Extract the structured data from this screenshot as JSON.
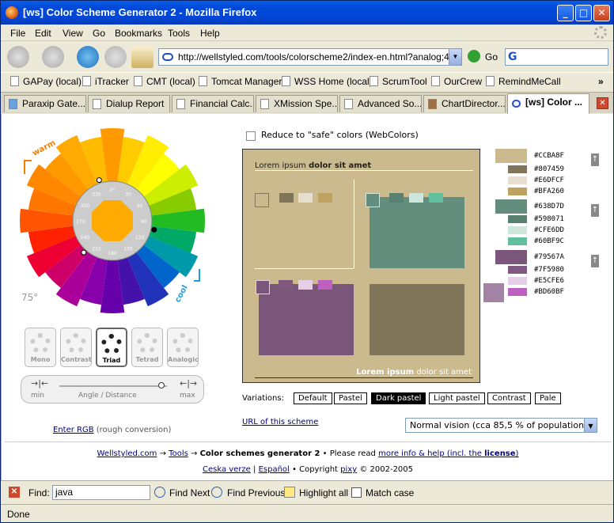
{
  "window": {
    "title": "[ws] Color Scheme Generator 2 - Mozilla Firefox",
    "minimize": "_",
    "maximize": "□",
    "close": "✕"
  },
  "menu": [
    "File",
    "Edit",
    "View",
    "Go",
    "Bookmarks",
    "Tools",
    "Help"
  ],
  "nav": {
    "url": "http://wellstyled.com/tools/colorscheme2/index-en.html?analog;46;0;",
    "go_label": "Go",
    "search_value": "G"
  },
  "bookmarks": [
    "GAPay (local)",
    "iTracker",
    "CMT (local)",
    "Tomcat Manager",
    "WSS Home (local)",
    "ScrumTool",
    "OurCrew",
    "RemindMeCall"
  ],
  "bookmarks_more": "»",
  "tabs": [
    "Paraxip Gate...",
    "Dialup Report",
    "Financial Calc...",
    "XMission Spe...",
    "Advanced So...",
    "ChartDirector...",
    "[ws] Color ..."
  ],
  "tab_close": "✕",
  "wheel": {
    "warm_label": "warm",
    "cool_label": "cool",
    "angle_label": "75°",
    "degree_ticks": [
      "0°",
      "30",
      "60",
      "90",
      "120",
      "150",
      "180",
      "210",
      "240",
      "270",
      "300",
      "330"
    ]
  },
  "modes": [
    {
      "label": "Mono"
    },
    {
      "label": "Contrast"
    },
    {
      "label": "Triad",
      "selected": true
    },
    {
      "label": "Tetrad"
    },
    {
      "label": "Analogic"
    }
  ],
  "slider": {
    "label": "Angle / Distance",
    "min": "min",
    "max": "max",
    "position": 0.95
  },
  "enter_rgb": {
    "link": "Enter RGB",
    "note": "(rough conversion)"
  },
  "safe_colors_label": "Reduce to \"safe\" colors (WebColors)",
  "preview": {
    "heading_normal": "Lorem ipsum",
    "heading_bold": "dolor sit amet",
    "footer_bold": "Lorem ipsum",
    "footer_normal": "dolor sit amet"
  },
  "palette": {
    "groups": [
      {
        "main": "#CCBA8F",
        "colors": [
          "#CCBA8F",
          "#807459",
          "#E6DFCF",
          "#BFA260"
        ],
        "labels": [
          "#CCBA8F",
          "#807459",
          "#E6DFCF",
          "#BFA260"
        ]
      },
      {
        "main": "#638D7D",
        "colors": [
          "#638D7D",
          "#598071",
          "#CFE6DD",
          "#60BF9C"
        ],
        "labels": [
          "#638D7D",
          "#598071",
          "#CFE6DD",
          "#60BF9C"
        ]
      },
      {
        "main": "#79567A",
        "colors": [
          "#79567A",
          "#7F5980",
          "#E5CFE6",
          "#BD60BF"
        ],
        "labels": [
          "#79567A",
          "#7F5980",
          "#E5CFE6",
          "#BD60BF"
        ]
      }
    ],
    "complement": "#A383A3",
    "lock_icon": "↑"
  },
  "variations": {
    "label": "Variations:",
    "options": [
      "Default",
      "Pastel",
      "Dark pastel",
      "Light pastel",
      "Contrast",
      "Pale"
    ],
    "selected": "Dark pastel"
  },
  "url_scheme": "URL of this scheme",
  "vision_select": "Normal vision (cca 85,5 % of population)",
  "footer": {
    "crumb1": "Wellstyled.com",
    "arrow1": "→",
    "crumb2": "Tools",
    "arrow2": "→",
    "crumb3": "Color schemes generator 2",
    "bullet1": "• Please read",
    "help_link": "more info & help (incl. the",
    "license": "license",
    ")": ")",
    "lang1": "Ceska verze",
    "sep": "|",
    "lang2": "Español",
    "copy": "• Copyright",
    "author": "pixy",
    "years": "© 2002-2005"
  },
  "findbar": {
    "label": "Find:",
    "value": "java",
    "next": "Find Next",
    "prev": "Find Previous",
    "highlight": "Highlight all",
    "match": "Match case"
  },
  "status": "Done"
}
